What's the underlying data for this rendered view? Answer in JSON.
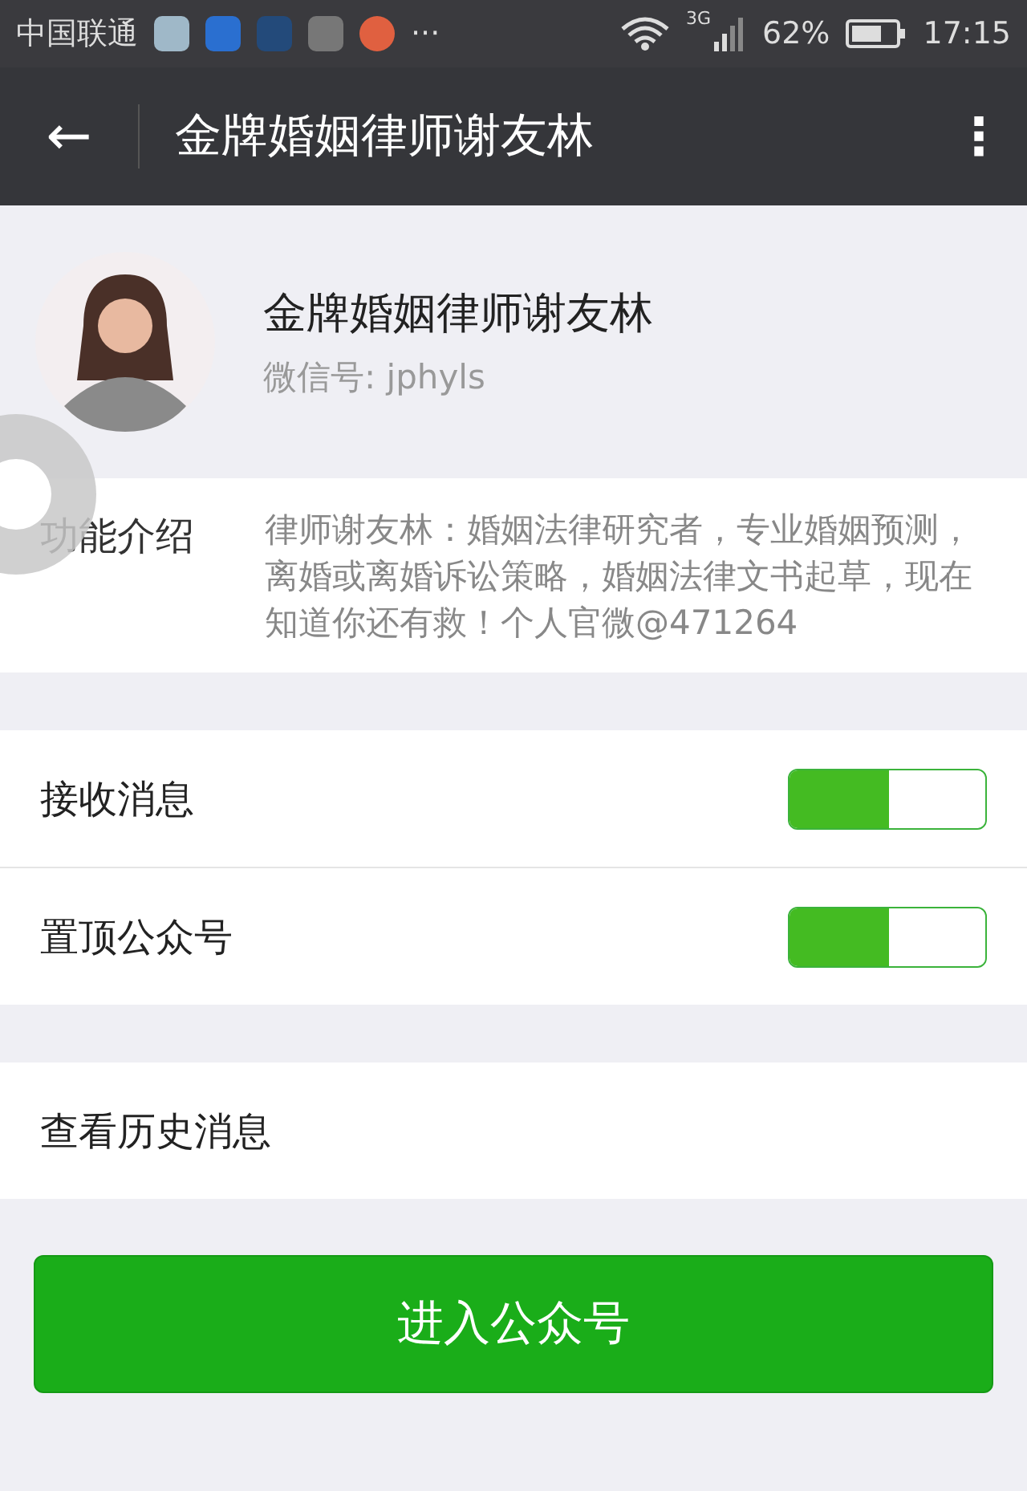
{
  "status_bar": {
    "carrier": "中国联通",
    "more": "···",
    "network": "3G",
    "battery": "62%",
    "time": "17:15"
  },
  "title_bar": {
    "back": "←",
    "title": "金牌婚姻律师谢友林",
    "menu": "⋮"
  },
  "profile": {
    "name": "金牌婚姻律师谢友林",
    "wechat_id": "微信号: jphyls"
  },
  "intro": {
    "label": "功能介绍",
    "text": "律师谢友林：婚姻法律研究者，专业婚姻预测，离婚或离婚诉讼策略，婚姻法律文书起草，现在知道你还有救！个人官微@471264"
  },
  "settings": [
    {
      "label": "接收消息",
      "on": true
    },
    {
      "label": "置顶公众号",
      "on": true
    }
  ],
  "history": {
    "label": "查看历史消息"
  },
  "enter_button": {
    "label": "进入公众号"
  }
}
